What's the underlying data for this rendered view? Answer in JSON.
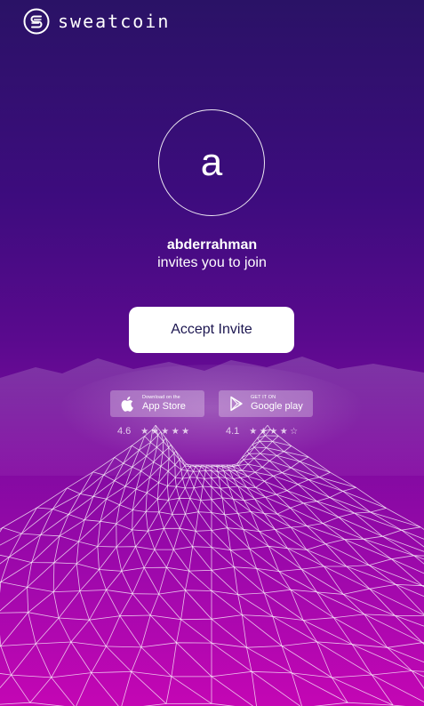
{
  "brand": {
    "name": "sweatcoin",
    "logo_icon": "sweatcoin-s-icon"
  },
  "inviter": {
    "avatar_letter": "a",
    "name": "abderrahman",
    "message": "invites you to join"
  },
  "cta": {
    "label": "Accept Invite"
  },
  "stores": [
    {
      "id": "apple",
      "small_label": "Download on the",
      "big_label": "App Store",
      "icon": "apple-icon",
      "rating": "4.6",
      "stars": "★★★★★"
    },
    {
      "id": "google",
      "small_label": "GET IT ON",
      "big_label": "Google play",
      "icon": "google-play-icon",
      "rating": "4.1",
      "stars": "★★★★☆"
    }
  ],
  "colors": {
    "gradient_top": "#2a1266",
    "gradient_bottom": "#c406b4",
    "button_text": "#1c1650"
  }
}
